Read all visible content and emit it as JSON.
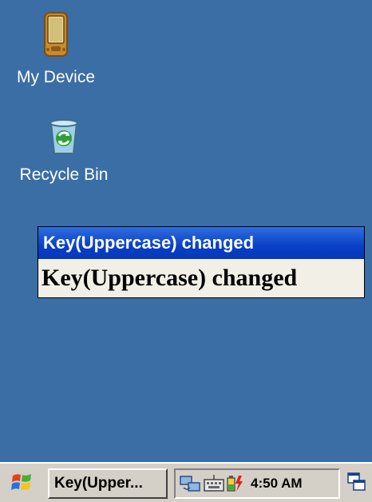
{
  "desktop": {
    "background_color": "#3A6EA5",
    "icons": [
      {
        "label": "My Device",
        "icon": "pda-device-icon"
      },
      {
        "label": "Recycle Bin",
        "icon": "recycle-bin-icon"
      }
    ]
  },
  "popup": {
    "title": "Key(Uppercase) changed",
    "message": "Key(Uppercase) changed",
    "title_color": "#0A3FC6",
    "body_color": "#F1EFE6"
  },
  "taskbar": {
    "start_icon": "windows-flag-icon",
    "task_button_label": "Key(Upper...",
    "tray_icons": [
      "network-icon",
      "keyboard-icon",
      "battery-charging-icon"
    ],
    "clock": "4:50 AM",
    "desktop_icon": "show-desktop-icon",
    "background_color": "#D4D0C8"
  }
}
